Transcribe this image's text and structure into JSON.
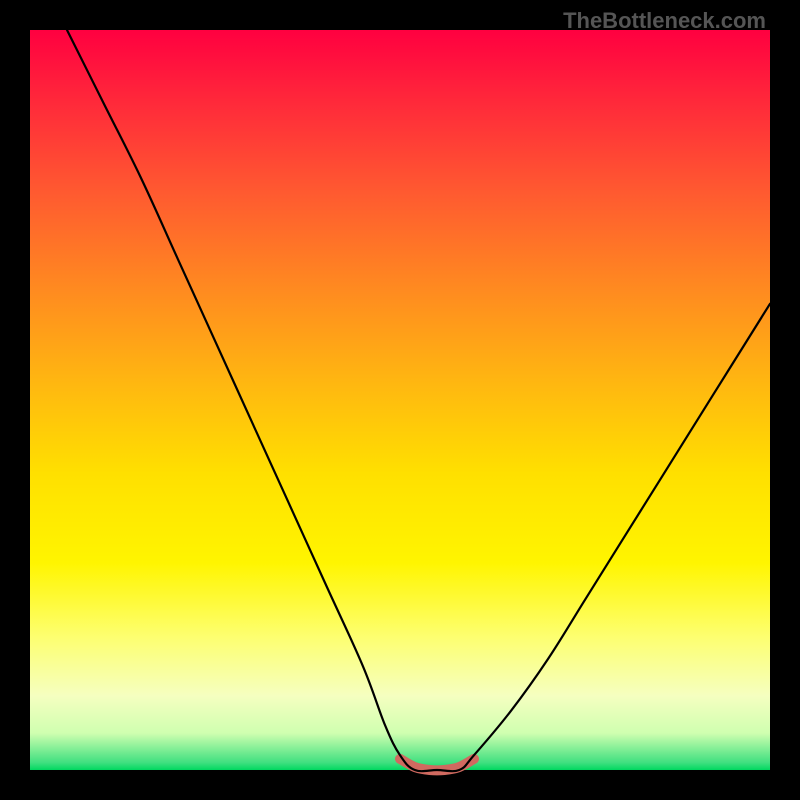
{
  "watermark": "TheBottleneck.com",
  "chart_data": {
    "type": "line",
    "title": "",
    "xlabel": "",
    "ylabel": "",
    "xlim": [
      0,
      100
    ],
    "ylim": [
      0,
      100
    ],
    "series": [
      {
        "name": "bottleneck-curve",
        "x": [
          5,
          10,
          15,
          20,
          25,
          30,
          35,
          40,
          45,
          48,
          50,
          52,
          55,
          58,
          60,
          65,
          70,
          75,
          80,
          85,
          90,
          95,
          100
        ],
        "values": [
          100,
          90,
          80,
          69,
          58,
          47,
          36,
          25,
          14,
          6,
          2,
          0,
          0,
          0,
          2,
          8,
          15,
          23,
          31,
          39,
          47,
          55,
          63
        ]
      },
      {
        "name": "highlight-band",
        "x": [
          50,
          52,
          54,
          56,
          58,
          60
        ],
        "values": [
          1.5,
          0.4,
          0,
          0,
          0.4,
          1.5
        ]
      }
    ],
    "annotations": []
  },
  "colors": {
    "curve": "#000000",
    "highlight": "#d06a60"
  }
}
